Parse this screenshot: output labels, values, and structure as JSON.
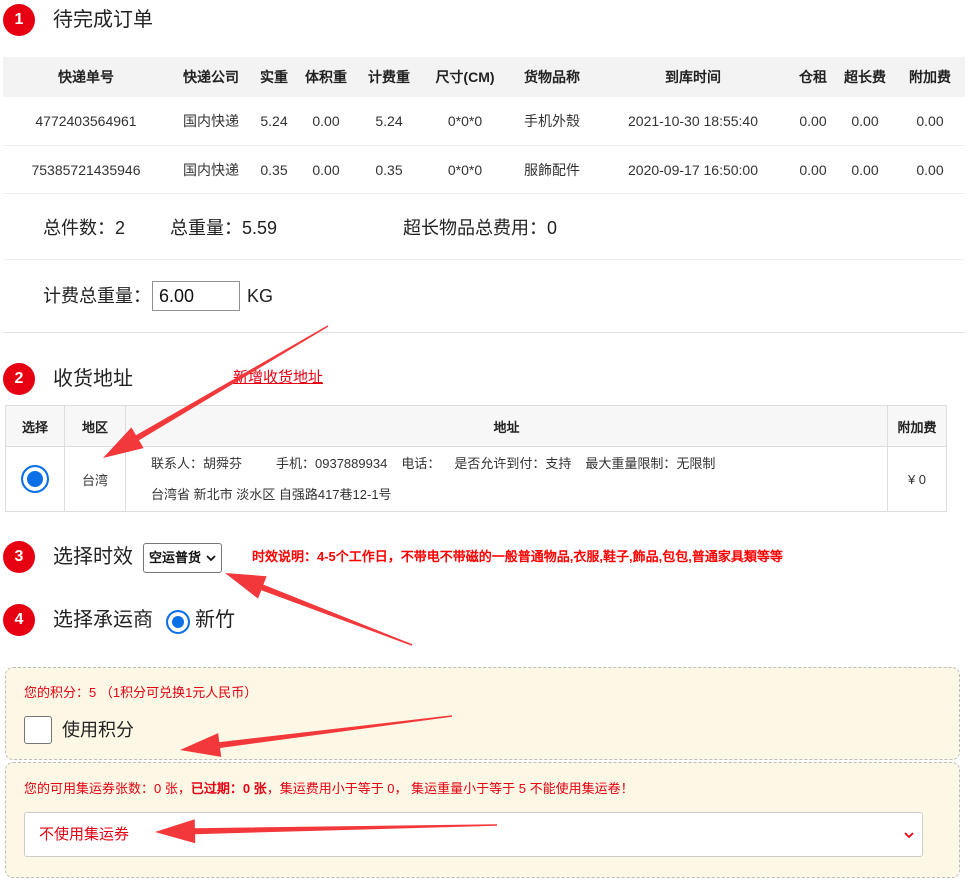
{
  "colors": {
    "accent_red": "#e60012",
    "notice_red": "#ff0000",
    "radio_blue": "#0b6fe8",
    "notice_box_bg": "#fdf8e5",
    "annotation_arrow": "#f2383a"
  },
  "icons": {
    "timing_select_caret": "chevron-down-icon",
    "coupon_select_caret": "chevron-down-icon"
  },
  "orders": {
    "step": "1",
    "title": "待完成订单",
    "columns": [
      "快递单号",
      "快递公司",
      "实重",
      "体积重",
      "计费重",
      "尺寸(CM)",
      "货物品称",
      "到库时间",
      "仓租",
      "超长费",
      "附加费"
    ],
    "rows": [
      [
        "4772403564961",
        "国内快递",
        "5.24",
        "0.00",
        "5.24",
        "0*0*0",
        "手机外殼",
        "2021-10-30 18:55:40",
        "0.00",
        "0.00",
        "0.00"
      ],
      [
        "75385721435946",
        "国内快递",
        "0.35",
        "0.00",
        "0.35",
        "0*0*0",
        "服飾配件",
        "2020-09-17 16:50:00",
        "0.00",
        "0.00",
        "0.00"
      ]
    ],
    "summary": {
      "count_label": "总件数：",
      "count": "2",
      "weight_label": "总重量：",
      "weight": "5.59",
      "oversize_label": "超长物品总费用：",
      "oversize_fee": "0"
    },
    "billing_weight": {
      "label": "计费总重量：",
      "value": "6.00",
      "unit": "KG"
    }
  },
  "address": {
    "step": "2",
    "title": "收货地址",
    "add_link": "新增收货地址",
    "columns": [
      "选择",
      "地区",
      "地址",
      "附加费"
    ],
    "entries": [
      {
        "selected": true,
        "region": "台湾",
        "contact": "联系人：胡舜芬",
        "mobile": "手机：0937889934",
        "phone": "电话：",
        "cod": "是否允许到付：支持",
        "max_weight": "最大重量限制：无限制",
        "full_address": "台湾省 新北市 淡水区 自强路417巷12-1号",
        "fee": "¥ 0"
      }
    ]
  },
  "timing": {
    "step": "3",
    "title": "选择时效",
    "selected": "空运普货",
    "note": "时效说明：4-5个工作日，不带电不带磁的一般普通物品,衣服,鞋子,飾品,包包,普通家具類等等"
  },
  "carrier": {
    "step": "4",
    "title": "选择承运商",
    "options": [
      {
        "label": "新竹",
        "selected": true
      }
    ]
  },
  "points": {
    "info": "您的积分：5 （1积分可兑换1元人民币）",
    "use_label": "使用积分",
    "use_checked": false
  },
  "coupons": {
    "info_count": "您的可用集运券张数：0 张，",
    "info_expired": "已过期：0 张",
    "info_rule": "，集运费用小于等于 0， 集运重量小于等于 5 不能使用集运卷！",
    "selected": "不使用集运券"
  }
}
